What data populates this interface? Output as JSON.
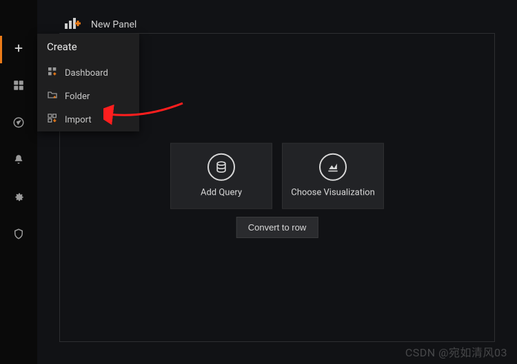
{
  "panel": {
    "title": "New Panel"
  },
  "sidebar": {
    "active": "create"
  },
  "flyout": {
    "header": "Create",
    "items": [
      {
        "label": "Dashboard"
      },
      {
        "label": "Folder"
      },
      {
        "label": "Import"
      }
    ]
  },
  "center": {
    "addQuery": "Add Query",
    "chooseVis": "Choose Visualization",
    "convert": "Convert to row"
  },
  "watermark": "CSDN @宛如清风03"
}
